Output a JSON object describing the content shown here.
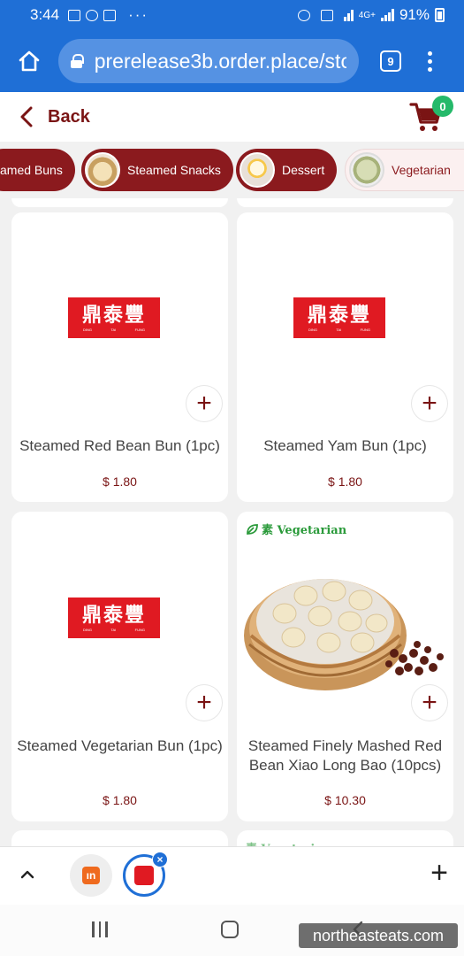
{
  "status_bar": {
    "time": "3:44",
    "dots": "···",
    "network": "4G+",
    "battery": "91%"
  },
  "browser": {
    "url": "prerelease3b.order.place/sto",
    "tab_count": "9"
  },
  "header": {
    "back_label": "Back",
    "cart_count": "0"
  },
  "categories": [
    {
      "label": "amed Buns",
      "style": "selected-partial"
    },
    {
      "label": "Steamed Snacks",
      "style": "dark"
    },
    {
      "label": "Dessert",
      "style": "dark"
    },
    {
      "label": "Vegetarian",
      "style": "light"
    }
  ],
  "products": [
    {
      "name": "Steamed Red Bean Bun (1pc)",
      "price": "$ 1.80"
    },
    {
      "name": "Steamed Yam Bun (1pc)",
      "price": "$ 1.80"
    },
    {
      "name": "Steamed Vegetarian Bun (1pc)",
      "price": "$ 1.80"
    },
    {
      "name": "Steamed Finely Mashed Red Bean Xiao Long Bao (10pcs)",
      "price": "$ 10.30",
      "tag": "素 Vegetarian"
    }
  ],
  "peek_tag": "素 Vegetarian",
  "logo": {
    "cjk": "鼎泰豐",
    "sub": [
      "DING",
      "TAI",
      "FUNG"
    ]
  },
  "tab_strip": {
    "first_tab_glyph": "ın"
  },
  "watermark": "northeasteats.com",
  "colors": {
    "browser_blue": "#1f6fd6",
    "brand_maroon": "#8b1a1e",
    "price_red": "#7a1414",
    "badge_green": "#25b96a",
    "logo_red": "#e01a22",
    "veg_green": "#2a9a3a"
  }
}
